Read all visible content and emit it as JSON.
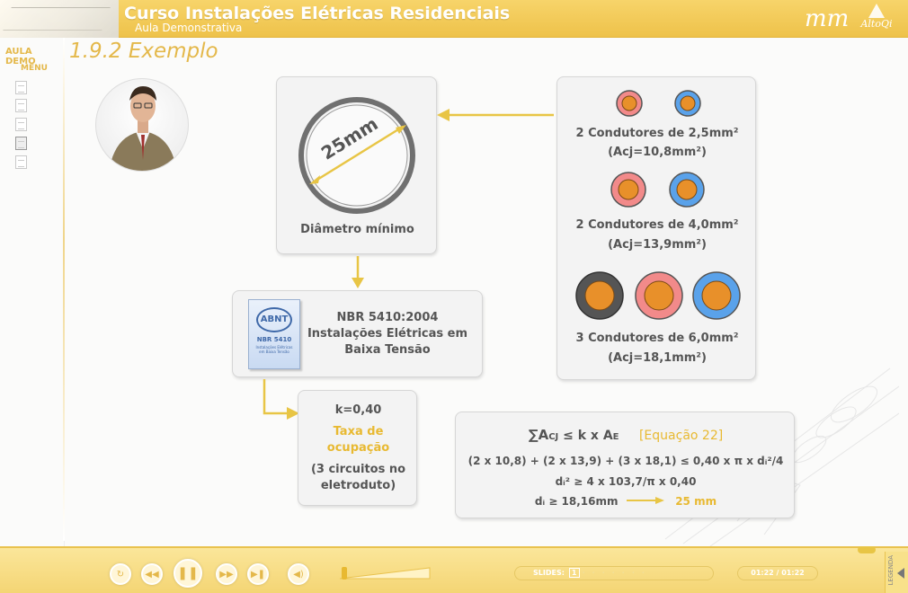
{
  "header": {
    "title": "Curso Instalações Elétricas Residenciais",
    "subtitle": "Aula Demonstrativa",
    "logo_mm": "mm",
    "logo_altoqi": "AltoQi"
  },
  "sidebar": {
    "aula_demo": "AULA DEMO",
    "menu": "MENU",
    "items": [
      {
        "icon": "document-icon",
        "active": false
      },
      {
        "icon": "document-icon",
        "active": false
      },
      {
        "icon": "document-icon",
        "active": false
      },
      {
        "icon": "document-icon",
        "active": true
      },
      {
        "icon": "document-icon",
        "active": false
      }
    ]
  },
  "page": {
    "title": "1.9.2 Exemplo"
  },
  "diameter_card": {
    "diameter_label": "25mm",
    "caption": "Diâmetro mínimo"
  },
  "conductors_card": {
    "groups": [
      {
        "label": "2 Condutores de 2,5mm²",
        "area": "(Acj=10,8mm²)"
      },
      {
        "label": "2 Condutores de 4,0mm²",
        "area": "(Acj=13,9mm²)"
      },
      {
        "label": "3 Condutores de 6,0mm²",
        "area": "(Acj=18,1mm²)"
      }
    ]
  },
  "norm_card": {
    "book_title": "ABNT",
    "book_code": "NBR 5410",
    "book_sub": "Instalações Elétricas em Baixa Tensão",
    "line1": "NBR 5410:2004",
    "line2": "Instalações Elétricas em",
    "line3": "Baixa Tensão"
  },
  "k_card": {
    "k": "k=0,40",
    "taxa1": "Taxa de",
    "taxa2": "ocupação",
    "note1": "(3 circuitos no",
    "note2": "eletroduto)"
  },
  "formula_card": {
    "eq_main": "∑A",
    "eq_sub_cj": "CJ",
    "eq_mid": " ≤ k x A",
    "eq_sub_e": "E",
    "eq_ref": "[Equação 22]",
    "line2": "(2 x 10,8) + (2 x 13,9) + (3 x 18,1) ≤ 0,40 x π x dᵢ²/4",
    "line3": "dᵢ² ≥ 4 x 103,7/π x 0,40",
    "line4": "dᵢ ≥ 18,16mm",
    "result": "25 mm"
  },
  "footer": {
    "slides_label": "SLIDES:",
    "current_slide": "1",
    "time": "01:22 / 01:22",
    "legenda": "LEGENDA"
  },
  "colors": {
    "accent": "#e8b931",
    "header": "#f2cc5a",
    "red_conductor": "#f28a8a",
    "blue_conductor": "#5aa2ea",
    "black_conductor": "#555555",
    "copper": "#e8902a"
  }
}
